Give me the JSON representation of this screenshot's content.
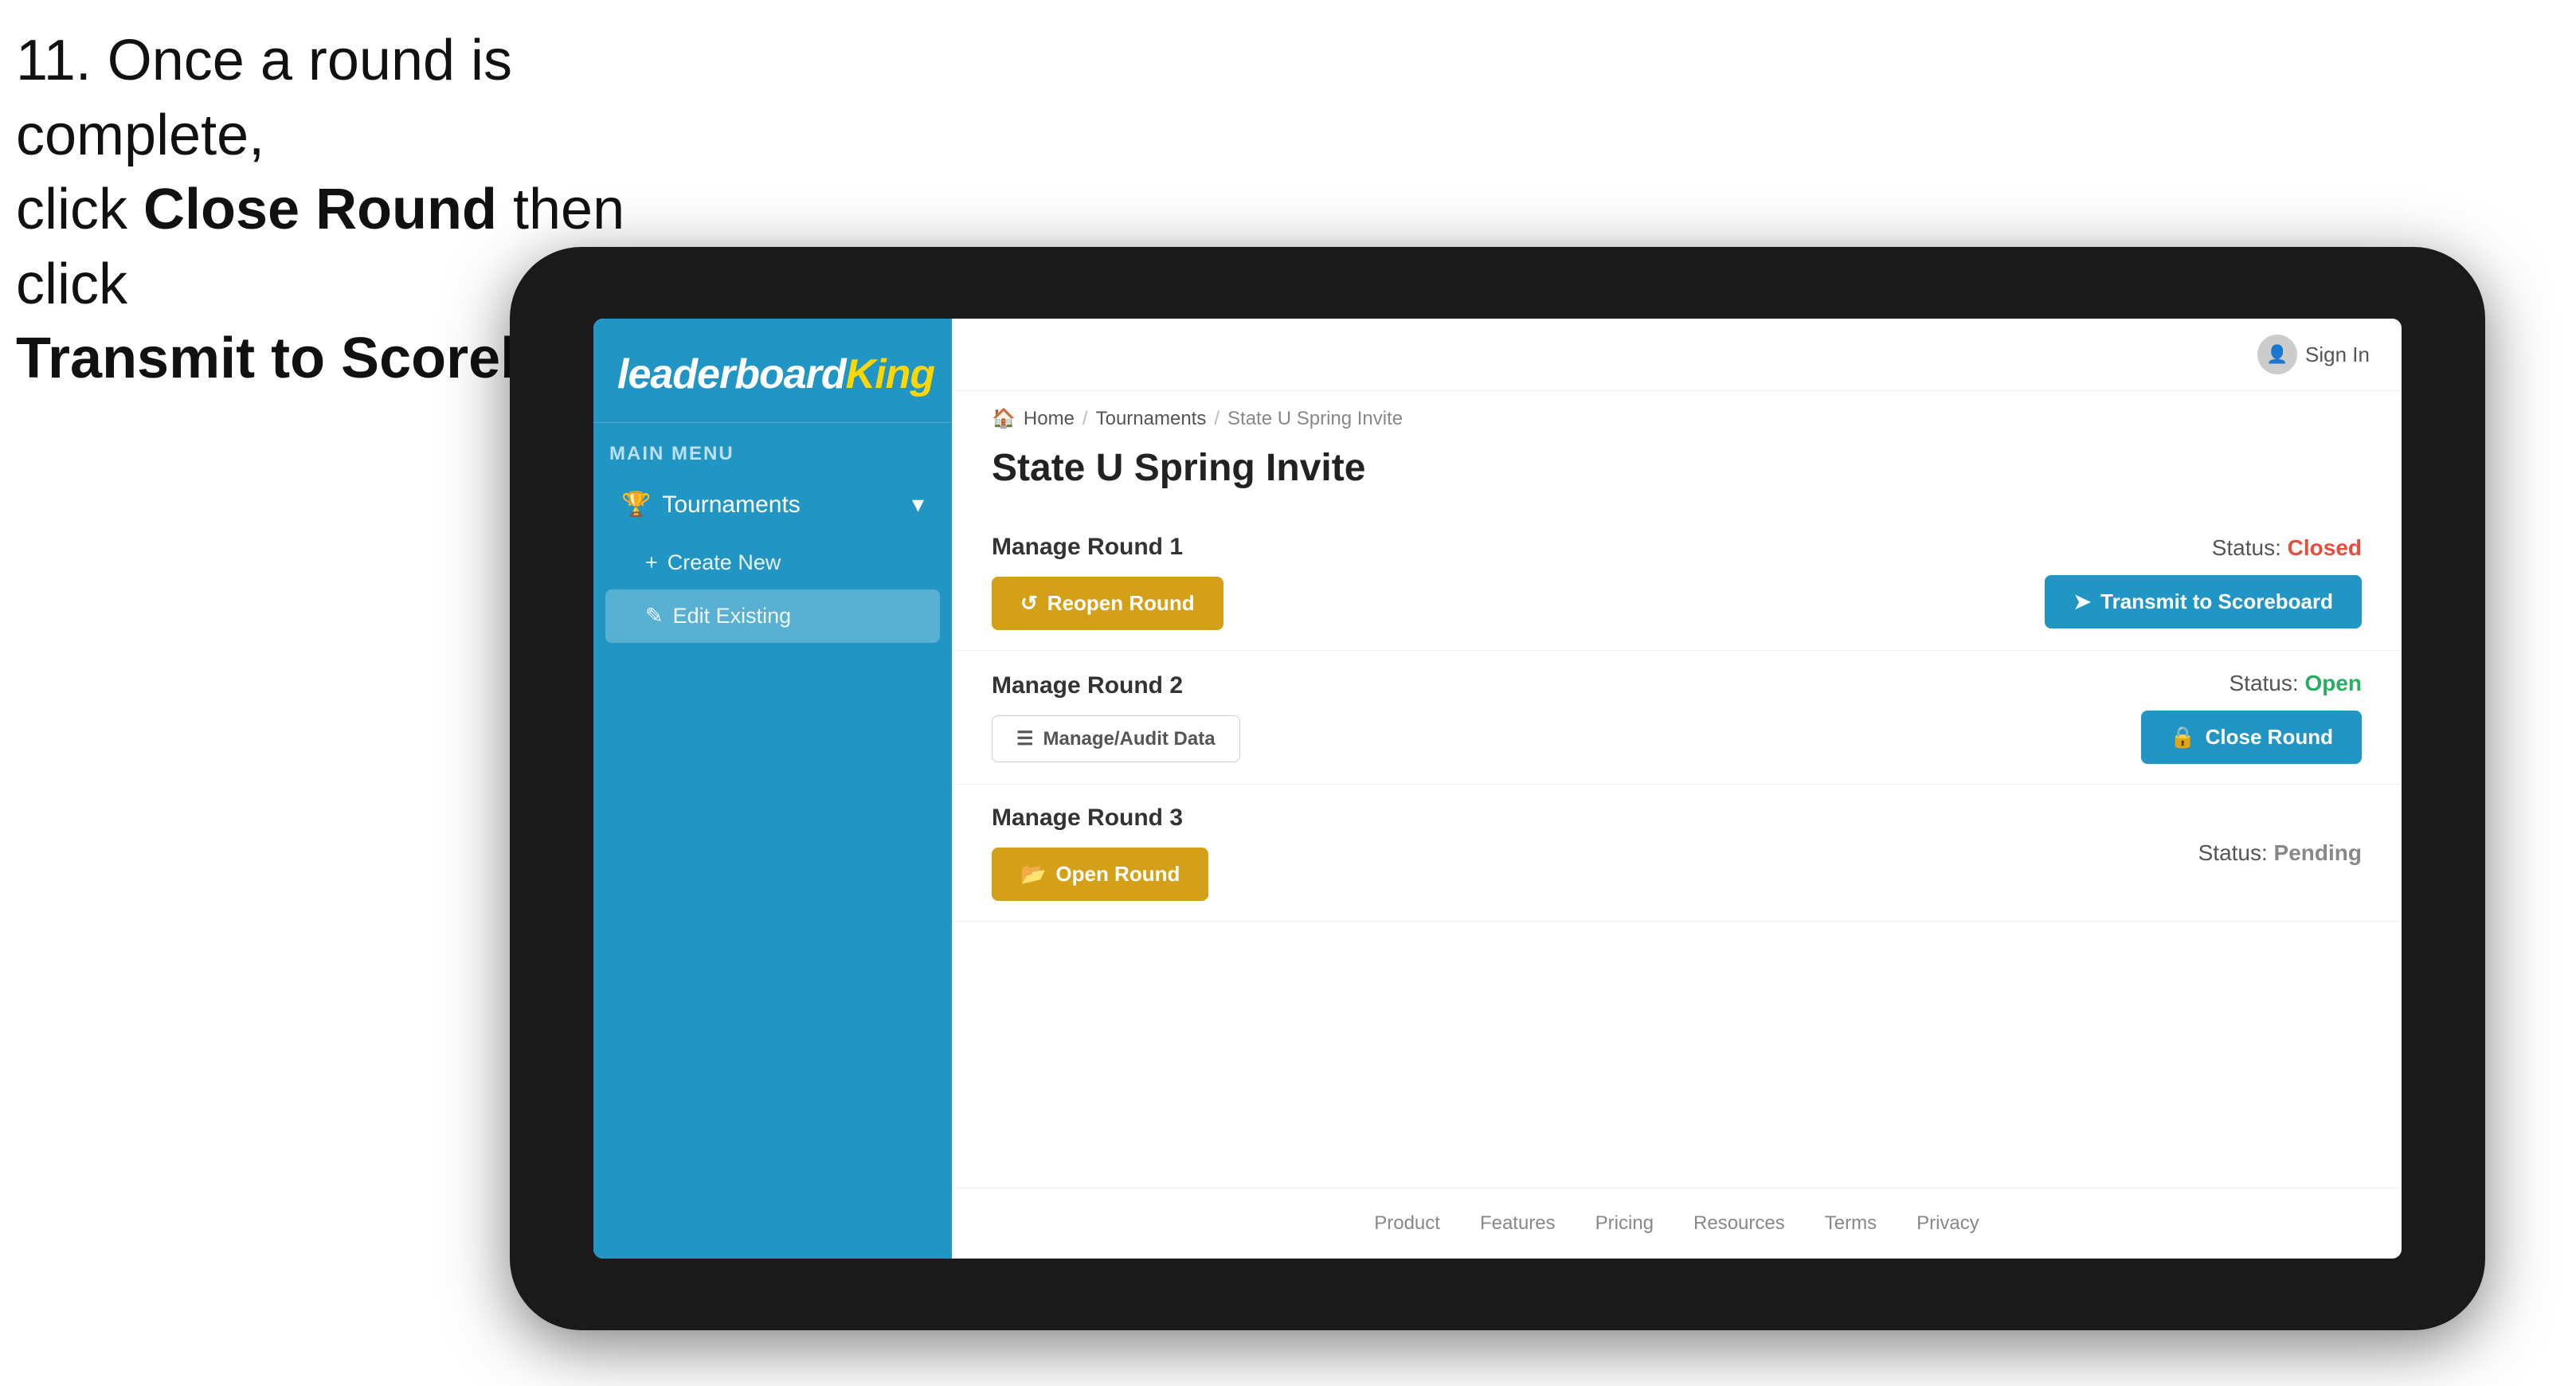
{
  "instruction": {
    "line1": "11. Once a round is complete,",
    "line2": "click ",
    "bold1": "Close Round",
    "line3": " then click",
    "line4": "",
    "bold2": "Transmit to Scoreboard."
  },
  "sidebar": {
    "logo": "leaderboard",
    "logo_king": "King",
    "main_menu_label": "MAIN MENU",
    "nav": {
      "tournaments_label": "Tournaments",
      "create_new_label": "Create New",
      "edit_existing_label": "Edit Existing"
    }
  },
  "topbar": {
    "sign_in_label": "Sign In"
  },
  "breadcrumb": {
    "home": "Home",
    "tournaments": "Tournaments",
    "current": "State U Spring Invite"
  },
  "page": {
    "title": "State U Spring Invite",
    "rounds": [
      {
        "id": 1,
        "title": "Manage Round 1",
        "status_label": "Status:",
        "status_value": "Closed",
        "status_type": "closed",
        "primary_button": "Reopen Round",
        "secondary_button": "Transmit to Scoreboard",
        "show_audit": false
      },
      {
        "id": 2,
        "title": "Manage Round 2",
        "status_label": "Status:",
        "status_value": "Open",
        "status_type": "open",
        "primary_button": "Manage/Audit Data",
        "secondary_button": "Close Round",
        "show_audit": true
      },
      {
        "id": 3,
        "title": "Manage Round 3",
        "status_label": "Status:",
        "status_value": "Pending",
        "status_type": "pending",
        "primary_button": "Open Round",
        "secondary_button": null,
        "show_audit": false
      }
    ]
  },
  "footer": {
    "links": [
      "Product",
      "Features",
      "Pricing",
      "Resources",
      "Terms",
      "Privacy"
    ]
  }
}
